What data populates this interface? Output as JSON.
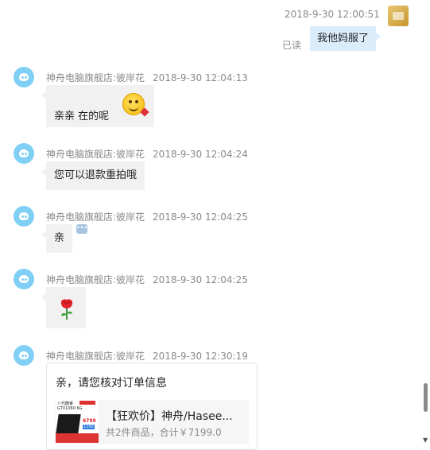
{
  "outgoing": {
    "timestamp": "2018-9-30 12:00:51",
    "message": "我他妈服了",
    "read_status": "已读"
  },
  "messages": [
    {
      "sender": "神舟电脑旗舰店:彼岸花",
      "time": "2018-9-30 12:04:13",
      "text": "亲亲  在的呢",
      "emoji": "smiley-heart"
    },
    {
      "sender": "神舟电脑旗舰店:彼岸花",
      "time": "2018-9-30 12:04:24",
      "text": "您可以退款重拍哦"
    },
    {
      "sender": "神舟电脑旗舰店:彼岸花",
      "time": "2018-9-30 12:04:25",
      "text": "亲",
      "status_icon": "typing-icon"
    },
    {
      "sender": "神舟电脑旗舰店:彼岸花",
      "time": "2018-9-30 12:04:25",
      "sticker": "rose-icon"
    },
    {
      "sender": "神舟电脑旗舰店:彼岸花",
      "time": "2018-9-30 12:30:19",
      "card": {
        "title": "亲，请您核对订单信息",
        "product_name": "【狂欢价】神舟/Hasee...",
        "product_meta": "共2件商品，合计￥7199.0",
        "thumb_texts": {
          "line1": "八代酷睿",
          "line2": "GTX1060 6G",
          "price": "6799",
          "tag": "1100"
        }
      }
    }
  ],
  "colors": {
    "avatar": "#7fd0f4",
    "bubble": "#f1f1f1",
    "my_bubble": "#dbecfb"
  }
}
